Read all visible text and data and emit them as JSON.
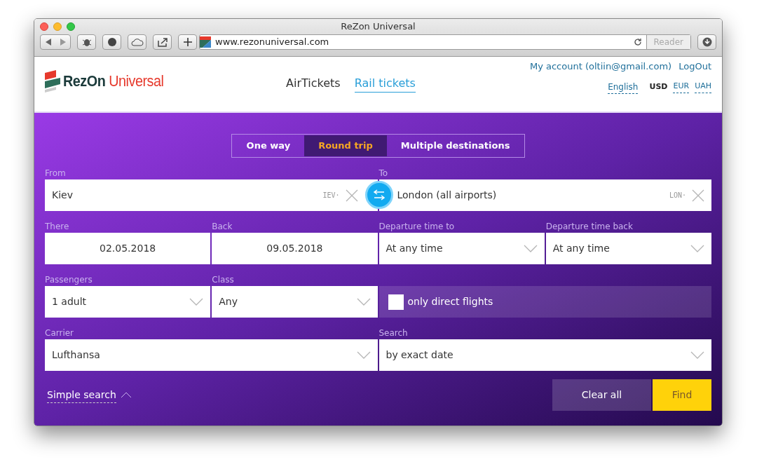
{
  "browser": {
    "title": "ReZon Universal",
    "url": "www.rezonuniversal.com",
    "reader": "Reader"
  },
  "header": {
    "logo_main": "RezOn",
    "logo_accent": "Universal",
    "nav": [
      {
        "label": "AirTickets",
        "selected": false
      },
      {
        "label": "Rail tickets",
        "selected": true
      }
    ],
    "account": "My account (oltiin@gmail.com)",
    "logout": "LogOut",
    "language": "English",
    "currencies": [
      {
        "label": "USD",
        "selected": true
      },
      {
        "label": "EUR",
        "selected": false
      },
      {
        "label": "UAH",
        "selected": false
      }
    ]
  },
  "trip_types": [
    {
      "label": "One way",
      "selected": false
    },
    {
      "label": "Round trip",
      "selected": true
    },
    {
      "label": "Multiple destinations",
      "selected": false
    }
  ],
  "route": {
    "from": {
      "label": "From",
      "value": "Kiev",
      "code": "IEV·"
    },
    "to": {
      "label": "To",
      "value": "London (all airports)",
      "code": "LON·"
    }
  },
  "fields": [
    {
      "kind": "date",
      "label": "There",
      "value": "02.05.2018"
    },
    {
      "kind": "date",
      "label": "Back",
      "value": "09.05.2018"
    },
    {
      "kind": "select",
      "label": "Departure time to",
      "value": "At any time"
    },
    {
      "kind": "select",
      "label": "Departure time back",
      "value": "At any time"
    },
    {
      "kind": "select",
      "label": "Passengers",
      "value": "1 adult"
    },
    {
      "kind": "select",
      "label": "Class",
      "value": "Any"
    },
    {
      "kind": "checkbox",
      "value": "only direct flights",
      "checked": false
    },
    {
      "kind": "wide",
      "label": "Carrier",
      "value": "Lufthansa"
    },
    {
      "kind": "wide",
      "label": "Search",
      "value": "by exact date"
    }
  ],
  "footer": {
    "simple_search": "Simple search",
    "expanded": true,
    "clear": "Clear all",
    "find": "Find"
  }
}
